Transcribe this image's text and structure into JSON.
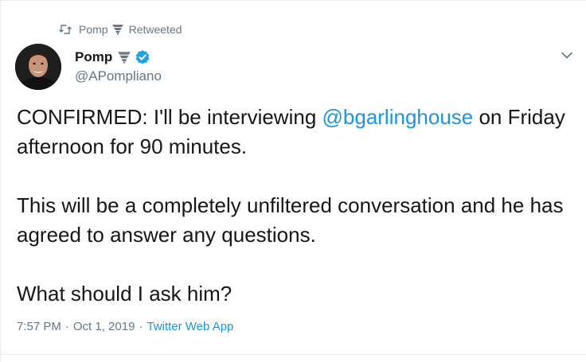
{
  "retweet_context": {
    "retweeter_name": "Pomp",
    "retweeter_emoji_icon": "tornado-icon",
    "label": "Retweeted"
  },
  "author": {
    "display_name": "Pomp",
    "handle": "@APompliano",
    "emoji_icon": "tornado-icon",
    "verified": true
  },
  "tweet": {
    "line1_prefix": "CONFIRMED: I'll be interviewing ",
    "mention": "@bgarlinghouse",
    "line1_suffix": " on Friday afternoon for 90 minutes.",
    "paragraph2": "This will be a completely unfiltered conversation and he has agreed to answer any questions.",
    "paragraph3": "What should I ask him?"
  },
  "meta": {
    "time": "7:57 PM",
    "separator": "·",
    "date": "Oct 1, 2019",
    "source": "Twitter Web App"
  },
  "colors": {
    "link": "#1b95e0",
    "secondary_text": "#657786",
    "primary_text": "#14171a",
    "verified_badge": "#1da1f2",
    "divider": "#e6ecf0"
  }
}
